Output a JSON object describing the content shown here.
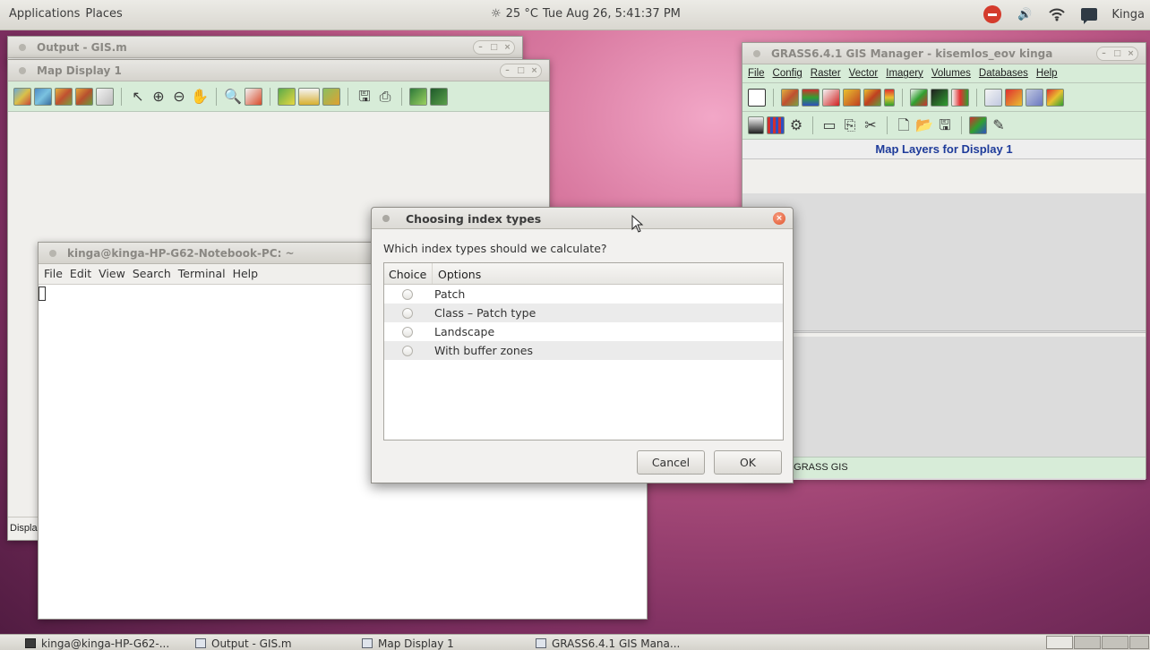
{
  "top_panel": {
    "menu": [
      "Applications",
      "Places"
    ],
    "weather": "25 °C",
    "datetime": "Tue Aug 26,  5:41:37 PM",
    "user": "Kinga"
  },
  "windows": {
    "output": {
      "title": "Output - GIS.m"
    },
    "map_display": {
      "title": "Map Display 1",
      "status_fragment": "Displa"
    },
    "terminal": {
      "title": "kinga@kinga-HP-G62-Notebook-PC: ~",
      "menu": [
        "File",
        "Edit",
        "View",
        "Search",
        "Terminal",
        "Help"
      ]
    },
    "grass": {
      "title": "GRASS6.4.1 GIS Manager - kisemlos_eov kinga",
      "menu": [
        "File",
        "Config",
        "Raster",
        "Vector",
        "Imagery",
        "Volumes",
        "Databases",
        "Help"
      ],
      "layers_header": "Map Layers for Display 1",
      "status": "o GRASS GIS"
    }
  },
  "dialog": {
    "title": "Choosing index types",
    "question": "Which index types should we calculate?",
    "columns": [
      "Choice",
      "Options"
    ],
    "options": [
      "Patch",
      "Class – Patch type",
      "Landscape",
      "With buffer zones"
    ],
    "cancel_label": "Cancel",
    "ok_label": "OK"
  },
  "taskbar": {
    "items": [
      "kinga@kinga-HP-G62-...",
      "Output - GIS.m",
      "Map Display 1",
      "GRASS6.4.1 GIS Mana..."
    ]
  },
  "colors": {
    "toolbar_green": "#d7ecd8",
    "layers_header_text": "#1e3b9a",
    "close_button": "#e0572f"
  }
}
